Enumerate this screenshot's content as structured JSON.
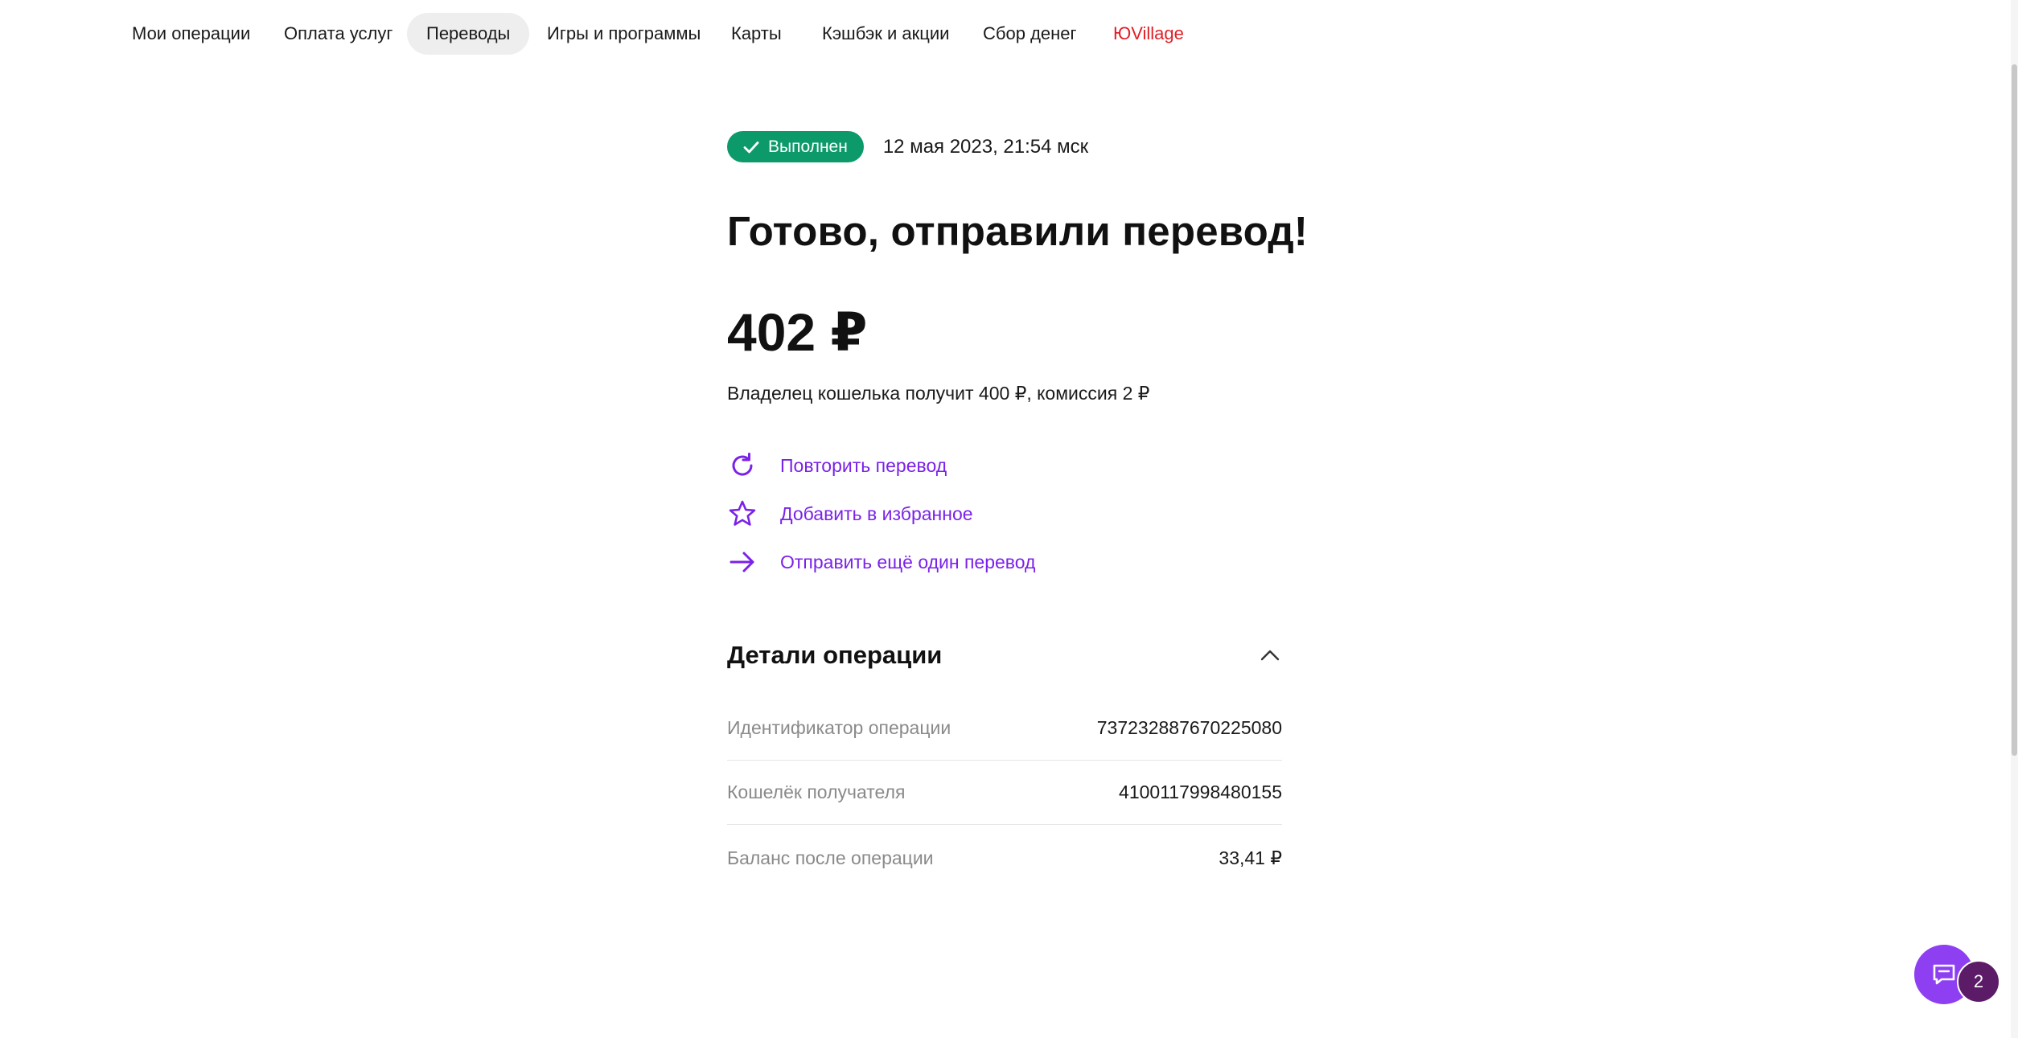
{
  "nav": {
    "tabs": [
      {
        "label": "Мои операции"
      },
      {
        "label": "Оплата услуг"
      },
      {
        "label": "Переводы"
      },
      {
        "label": "Игры и программы"
      },
      {
        "label": "Карты"
      },
      {
        "label": "Кэшбэк и акции"
      },
      {
        "label": "Сбор денег"
      },
      {
        "label": "ЮVillage"
      }
    ],
    "active_tab": "Переводы"
  },
  "status": {
    "badge": "Выполнен",
    "date": "12 мая 2023, 21:54 мск",
    "badge_color": "#0d9a6b"
  },
  "result": {
    "title": "Готово, отправили перевод!",
    "amount": "402 ₽",
    "subtitle": "Владелец кошелька получит 400 ₽, комиссия 2 ₽"
  },
  "actions": [
    {
      "label": "Повторить перевод",
      "icon": "repeat-icon"
    },
    {
      "label": "Добавить в избранное",
      "icon": "star-icon"
    },
    {
      "label": "Отправить ещё один перевод",
      "icon": "arrow-right-icon"
    }
  ],
  "details": {
    "title": "Детали операции",
    "rows": [
      {
        "label": "Идентификатор операции",
        "value": "737232887670225080"
      },
      {
        "label": "Кошелёк получателя",
        "value": "4100117998480155"
      },
      {
        "label": "Баланс после операции",
        "value": "33,41 ₽"
      }
    ]
  },
  "chat": {
    "count": "2"
  },
  "colors": {
    "accent": "#7b22e8",
    "brand_red": "#e01f26",
    "chat": "#8e3ff2"
  }
}
